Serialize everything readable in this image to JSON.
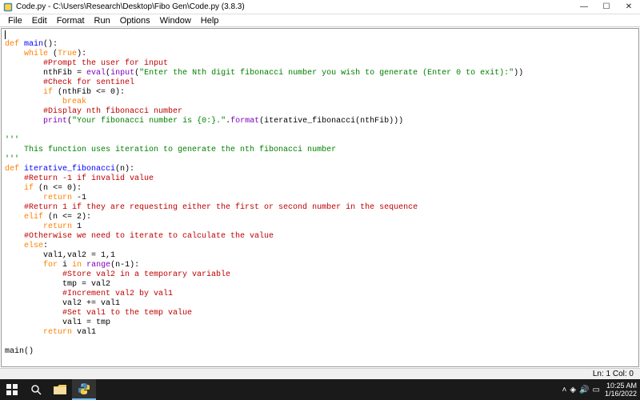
{
  "titlebar": {
    "title": "Code.py - C:\\Users\\Research\\Desktop\\Fibo Gen\\Code.py (3.8.3)"
  },
  "menubar": {
    "items": [
      "File",
      "Edit",
      "Format",
      "Run",
      "Options",
      "Window",
      "Help"
    ]
  },
  "code": {
    "l1_kw": "def",
    "l1_name": " main",
    "l1_rest": "():",
    "l2_kw": "while",
    "l2_par": " (",
    "l2_true": "True",
    "l2_rest": "):",
    "l3": "        #Prompt the user for input",
    "l4_a": "        nthFib = ",
    "l4_eval": "eval",
    "l4_b": "(",
    "l4_input": "input",
    "l4_c": "(",
    "l4_str": "\"Enter the Nth digit fibonacci number you wish to generate (Enter 0 to exit):\"",
    "l4_d": "))",
    "l5": "        #Check for sentinel",
    "l6_kw": "if",
    "l6_rest": " (nthFib <= 0):",
    "l7_kw": "break",
    "l8": "        #Display nth fibonacci number",
    "l9_print": "print",
    "l9_a": "(",
    "l9_str": "\"Your fibonacci number is {0:}.\"",
    "l9_b": ".",
    "l9_format": "format",
    "l9_c": "(iterative_fibonacci(nthFib)))",
    "l10": "'''",
    "l11": "    This function uses iteration to generate the nth fibonacci number",
    "l12": "'''",
    "l13_kw": "def",
    "l13_name": " iterative_fibonacci",
    "l13_rest": "(n):",
    "l14": "    #Return -1 if invalid value",
    "l15_kw": "if",
    "l15_rest": " (n <= 0):",
    "l16_kw": "return",
    "l16_rest": " -1",
    "l17": "    #Return 1 if they are requesting either the first or second number in the sequence",
    "l18_kw": "elif",
    "l18_rest": " (n <= 2):",
    "l19_kw": "return",
    "l19_rest": " 1",
    "l20": "    #Otherwise we need to iterate to calculate the value",
    "l21_kw": "else",
    "l21_rest": ":",
    "l22": "        val1,val2 = 1,1",
    "l23_for": "for",
    "l23_a": " i ",
    "l23_in": "in",
    "l23_b": " ",
    "l23_range": "range",
    "l23_c": "(n-1):",
    "l24": "            #Store val2 in a temporary variable",
    "l25": "            tmp = val2",
    "l26": "            #Increment val2 by val1",
    "l27": "            val2 += val1",
    "l28": "            #Set val1 to the temp value",
    "l29": "            val1 = tmp",
    "l30_kw": "return",
    "l30_rest": " val1",
    "l31": "main()"
  },
  "statusbar": {
    "text": "Ln: 1  Col: 0"
  },
  "taskbar": {
    "time": "10:25 AM",
    "date": "1/16/2022"
  }
}
